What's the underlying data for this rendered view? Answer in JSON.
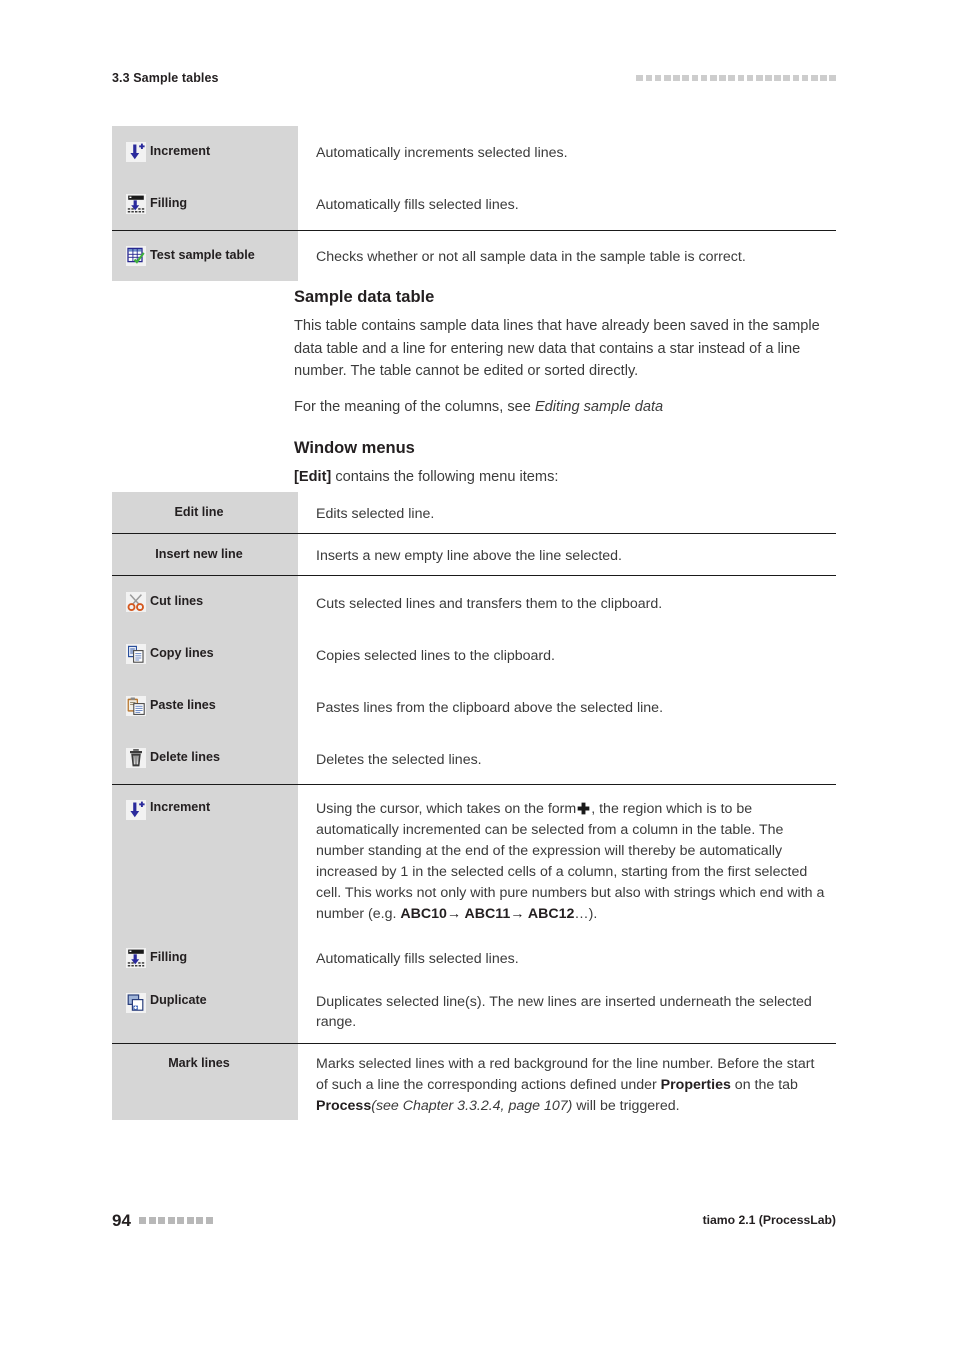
{
  "header": {
    "section_title": "3.3 Sample tables",
    "decoration_squares": 22,
    "decoration_color": "#cdcdcd"
  },
  "tables": {
    "toolbar_table": {
      "groups": [
        {
          "rows": [
            {
              "icon": "increment-icon",
              "label": "Increment",
              "description": "Automatically increments selected lines."
            },
            {
              "icon": "filling-icon",
              "label": "Filling",
              "description": "Automatically fills selected lines."
            }
          ]
        },
        {
          "rows": [
            {
              "icon": "test-sample-table-icon",
              "label": "Test sample table",
              "description": "Checks whether or not all sample data in the sample table is correct."
            }
          ]
        }
      ]
    },
    "edit_menu_table": {
      "groups": [
        {
          "rows": [
            {
              "icon": null,
              "label": "Edit line",
              "description": "Edits selected line."
            }
          ]
        },
        {
          "rows": [
            {
              "icon": null,
              "label": "Insert new line",
              "description": "Inserts a new empty line above the line selected."
            }
          ]
        },
        {
          "rows": [
            {
              "icon": "cut-icon",
              "label": "Cut lines",
              "description": "Cuts selected lines and transfers them to the clipboard."
            },
            {
              "icon": "copy-icon",
              "label": "Copy lines",
              "description": "Copies selected lines to the clipboard."
            },
            {
              "icon": "paste-icon",
              "label": "Paste lines",
              "description": "Pastes lines from the clipboard above the selected line."
            },
            {
              "icon": "delete-icon",
              "label": "Delete lines",
              "description": "Deletes the selected lines."
            }
          ]
        },
        {
          "rows": [
            {
              "icon": "increment-icon",
              "label": "Increment",
              "description": ""
            },
            {
              "icon": "filling-icon",
              "label": "Filling",
              "description": "Automatically fills selected lines."
            },
            {
              "icon": "duplicate-icon",
              "label": "Duplicate",
              "description": "Duplicates selected line(s). The new lines are inserted underneath the selected range."
            }
          ]
        },
        {
          "rows": [
            {
              "icon": null,
              "label": "Mark lines",
              "description": ""
            }
          ]
        }
      ]
    }
  },
  "increment_description": {
    "part1": "Using the cursor, which takes on the form",
    "part2": ", the region which is to be automatically incremented can be selected from a column in the table. The number standing at the end of the expression will thereby be automatically increased by 1 in the selected cells of a column, starting from the first selected cell. This works not only with pure numbers but also with strings which end with a number (e.g. ",
    "bold1": "ABC10",
    "arrow1": "→ ",
    "bold2": "ABC11",
    "arrow2": "→ ",
    "bold3": "ABC12",
    "tail": "…)."
  },
  "mark_lines_description": {
    "part1": "Marks selected lines with a red background for the line number. Before the start of such a line the corresponding actions defined under ",
    "bold1": "Properties",
    "part2": " on the tab ",
    "bold2": "Process",
    "italic1": "(see Chapter 3.3.2.4, page 107)",
    "part3": " will be triggered."
  },
  "prose": {
    "heading1": "Sample data table",
    "paragraph1": "This table contains sample data lines that have already been saved in the sample data table and a line for entering new data that contains a star instead of a line number. The table cannot be edited or sorted directly.",
    "paragraph2_lead": "For the meaning of the columns, see ",
    "paragraph2_italic": "Editing sample data",
    "heading2": "Window menus",
    "paragraph3_bold": "[Edit]",
    "paragraph3_rest": " contains the following menu items:"
  },
  "footer": {
    "page_number": "94",
    "decoration_squares": 8,
    "decoration_color": "#b8b8b8",
    "product": "tiamo 2.1 (ProcessLab)"
  },
  "colors": {
    "label_column_bg": "#d6d6d6",
    "rule": "#1a1a1a",
    "body_text": "#3b3b3b",
    "heading_text": "#231f20",
    "icon_blue": "#2a2a9c",
    "icon_green": "#3faf3f",
    "icon_orange": "#d4581f"
  }
}
